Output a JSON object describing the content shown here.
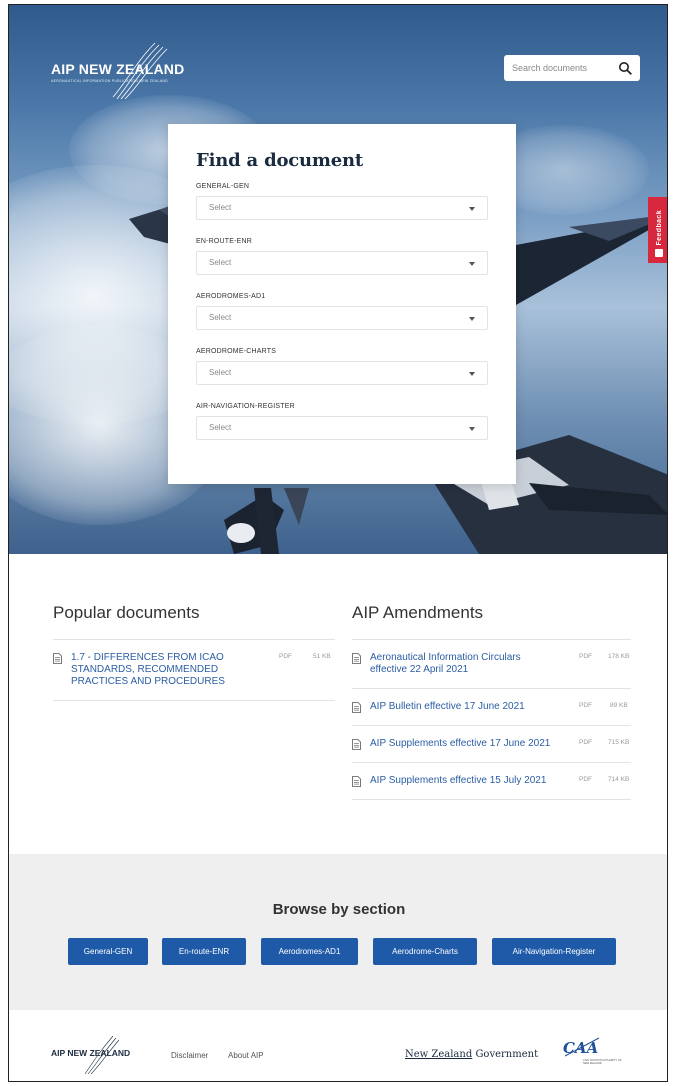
{
  "header": {
    "logo_text": "AIP NEW ZEALAND",
    "logo_subtitle": "AERONAUTICAL INFORMATION PUBLICATION NEW ZEALAND",
    "search_placeholder": "Search documents",
    "feedback_label": "Feedback"
  },
  "find_document": {
    "title": "Find a document",
    "fields": [
      {
        "label": "GENERAL-GEN",
        "value": "Select"
      },
      {
        "label": "EN-ROUTE-ENR",
        "value": "Select"
      },
      {
        "label": "AERODROMES-AD1",
        "value": "Select"
      },
      {
        "label": "AERODROME-CHARTS",
        "value": "Select"
      },
      {
        "label": "AIR-NAVIGATION-REGISTER",
        "value": "Select"
      }
    ]
  },
  "popular": {
    "title": "Popular documents",
    "items": [
      {
        "title": "1.7 - DIFFERENCES FROM ICAO STANDARDS, RECOMMENDED PRACTICES AND PROCEDURES",
        "type": "PDF",
        "size": "51 KB"
      }
    ]
  },
  "amendments": {
    "title": "AIP Amendments",
    "items": [
      {
        "title": "Aeronautical Information Circulars effective 22 April 2021",
        "type": "PDF",
        "size": "178 KB"
      },
      {
        "title": "AIP Bulletin effective 17 June 2021",
        "type": "PDF",
        "size": "89 KB"
      },
      {
        "title": "AIP Supplements effective 17 June 2021",
        "type": "PDF",
        "size": "715 KB"
      },
      {
        "title": "AIP Supplements effective 15 July 2021",
        "type": "PDF",
        "size": "714 KB"
      }
    ]
  },
  "browse": {
    "title": "Browse by section",
    "buttons": [
      "General-GEN",
      "En-route-ENR",
      "Aerodromes-AD1",
      "Aerodrome-Charts",
      "Air-Navigation-Register"
    ]
  },
  "footer": {
    "logo_text": "AIP NEW ZEALAND",
    "links": [
      "Disclaimer",
      "About AIP"
    ],
    "nzgov_part1": "New Zealand",
    "nzgov_part2": "Government",
    "caa_text": "CIVIL AVIATION AUTHORITY OF NEW ZEALAND",
    "caa_mark": "CAA"
  },
  "colors": {
    "accent_blue": "#1f5aa8",
    "link_blue": "#2b5ea3",
    "feedback_red": "#d8283e"
  }
}
